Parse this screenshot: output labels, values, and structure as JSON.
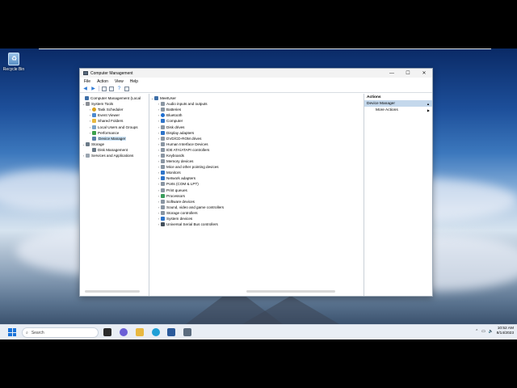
{
  "desktop": {
    "recycle_bin_label": "Recycle Bin"
  },
  "window": {
    "title": "Computer Management",
    "controls": {
      "minimize": "—",
      "maximize": "☐",
      "close": "✕"
    },
    "menu": [
      "File",
      "Action",
      "View",
      "Help"
    ],
    "tree": [
      {
        "label": "Computer Management (Local",
        "indent": 0,
        "icon": "computer-icon"
      },
      {
        "label": "System Tools",
        "indent": 1,
        "icon": "tools-icon"
      },
      {
        "label": "Task Scheduler",
        "indent": 2,
        "icon": "clock-icon"
      },
      {
        "label": "Event Viewer",
        "indent": 2,
        "icon": "log-icon"
      },
      {
        "label": "Shared Folders",
        "indent": 2,
        "icon": "folder-icon"
      },
      {
        "label": "Local Users and Groups",
        "indent": 2,
        "icon": "users-icon"
      },
      {
        "label": "Performance",
        "indent": 2,
        "icon": "performance-icon"
      },
      {
        "label": "Device Manager",
        "indent": 2,
        "icon": "device-manager-icon",
        "selected": true
      },
      {
        "label": "Storage",
        "indent": 1,
        "icon": "storage-icon"
      },
      {
        "label": "Disk Management",
        "indent": 2,
        "icon": "disk-icon"
      },
      {
        "label": "Services and Applications",
        "indent": 1,
        "icon": "services-icon"
      }
    ],
    "devices": {
      "root": "MeetUser",
      "categories": [
        "Audio inputs and outputs",
        "Batteries",
        "Bluetooth",
        "Computer",
        "Disk drives",
        "Display adapters",
        "DVD/CD-ROM drives",
        "Human Interface Devices",
        "IDE ATA/ATAPI controllers",
        "Keyboards",
        "Memory devices",
        "Mice and other pointing devices",
        "Monitors",
        "Network adapters",
        "Ports (COM & LPT)",
        "Print queues",
        "Processors",
        "Software devices",
        "Sound, video and game controllers",
        "Storage controllers",
        "System devices",
        "Universal Serial Bus controllers"
      ]
    },
    "actions": {
      "header": "Actions",
      "section": "Device Manager",
      "items": [
        "More Actions"
      ]
    }
  },
  "taskbar": {
    "search_placeholder": "Search",
    "time": "10:52 AM",
    "date": "8/14/2023"
  }
}
